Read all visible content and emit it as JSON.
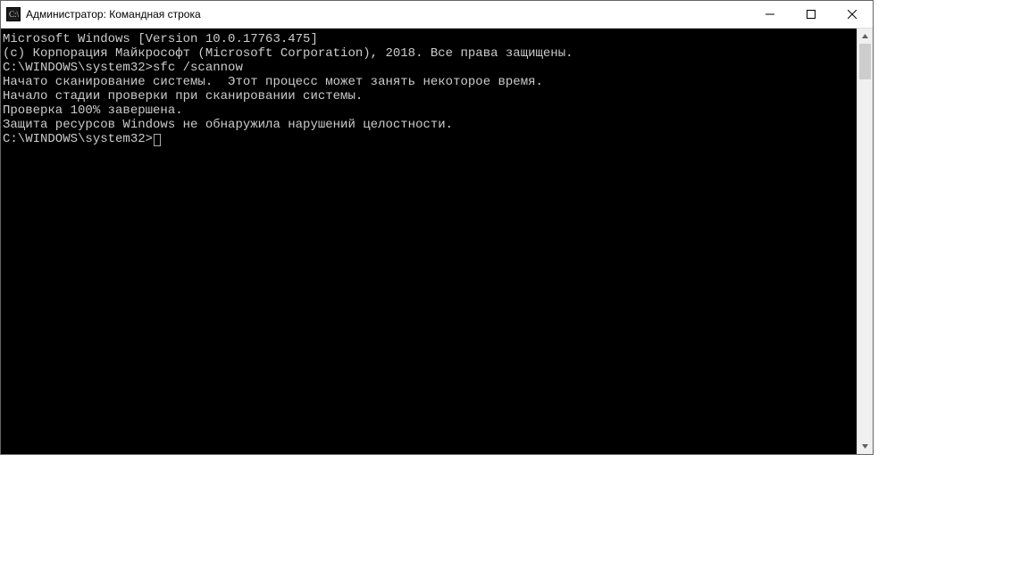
{
  "window": {
    "title": "Администратор: Командная строка"
  },
  "terminal": {
    "lines": [
      "Microsoft Windows [Version 10.0.17763.475]",
      "(c) Корпорация Майкрософт (Microsoft Corporation), 2018. Все права защищены.",
      "",
      "C:\\WINDOWS\\system32>sfc /scannow",
      "",
      "Начато сканирование системы.  Этот процесс может занять некоторое время.",
      "",
      "Начало стадии проверки при сканировании системы.",
      "Проверка 100% завершена.",
      "",
      "Защита ресурсов Windows не обнаружила нарушений целостности.",
      "",
      "C:\\WINDOWS\\system32>"
    ]
  }
}
